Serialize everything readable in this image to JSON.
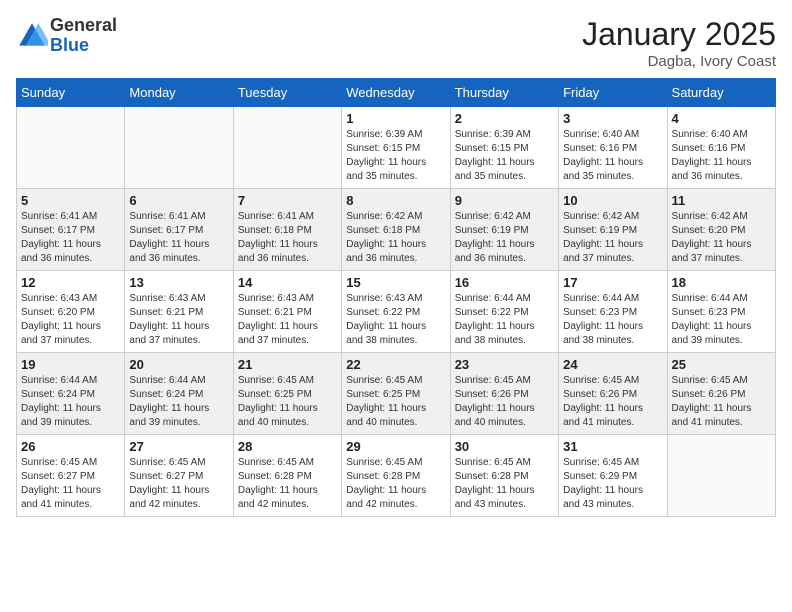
{
  "header": {
    "logo_general": "General",
    "logo_blue": "Blue",
    "month_title": "January 2025",
    "subtitle": "Dagba, Ivory Coast"
  },
  "days_of_week": [
    "Sunday",
    "Monday",
    "Tuesday",
    "Wednesday",
    "Thursday",
    "Friday",
    "Saturday"
  ],
  "weeks": [
    [
      {
        "day": "",
        "info": ""
      },
      {
        "day": "",
        "info": ""
      },
      {
        "day": "",
        "info": ""
      },
      {
        "day": "1",
        "info": "Sunrise: 6:39 AM\nSunset: 6:15 PM\nDaylight: 11 hours\nand 35 minutes."
      },
      {
        "day": "2",
        "info": "Sunrise: 6:39 AM\nSunset: 6:15 PM\nDaylight: 11 hours\nand 35 minutes."
      },
      {
        "day": "3",
        "info": "Sunrise: 6:40 AM\nSunset: 6:16 PM\nDaylight: 11 hours\nand 35 minutes."
      },
      {
        "day": "4",
        "info": "Sunrise: 6:40 AM\nSunset: 6:16 PM\nDaylight: 11 hours\nand 36 minutes."
      }
    ],
    [
      {
        "day": "5",
        "info": "Sunrise: 6:41 AM\nSunset: 6:17 PM\nDaylight: 11 hours\nand 36 minutes."
      },
      {
        "day": "6",
        "info": "Sunrise: 6:41 AM\nSunset: 6:17 PM\nDaylight: 11 hours\nand 36 minutes."
      },
      {
        "day": "7",
        "info": "Sunrise: 6:41 AM\nSunset: 6:18 PM\nDaylight: 11 hours\nand 36 minutes."
      },
      {
        "day": "8",
        "info": "Sunrise: 6:42 AM\nSunset: 6:18 PM\nDaylight: 11 hours\nand 36 minutes."
      },
      {
        "day": "9",
        "info": "Sunrise: 6:42 AM\nSunset: 6:19 PM\nDaylight: 11 hours\nand 36 minutes."
      },
      {
        "day": "10",
        "info": "Sunrise: 6:42 AM\nSunset: 6:19 PM\nDaylight: 11 hours\nand 37 minutes."
      },
      {
        "day": "11",
        "info": "Sunrise: 6:42 AM\nSunset: 6:20 PM\nDaylight: 11 hours\nand 37 minutes."
      }
    ],
    [
      {
        "day": "12",
        "info": "Sunrise: 6:43 AM\nSunset: 6:20 PM\nDaylight: 11 hours\nand 37 minutes."
      },
      {
        "day": "13",
        "info": "Sunrise: 6:43 AM\nSunset: 6:21 PM\nDaylight: 11 hours\nand 37 minutes."
      },
      {
        "day": "14",
        "info": "Sunrise: 6:43 AM\nSunset: 6:21 PM\nDaylight: 11 hours\nand 37 minutes."
      },
      {
        "day": "15",
        "info": "Sunrise: 6:43 AM\nSunset: 6:22 PM\nDaylight: 11 hours\nand 38 minutes."
      },
      {
        "day": "16",
        "info": "Sunrise: 6:44 AM\nSunset: 6:22 PM\nDaylight: 11 hours\nand 38 minutes."
      },
      {
        "day": "17",
        "info": "Sunrise: 6:44 AM\nSunset: 6:23 PM\nDaylight: 11 hours\nand 38 minutes."
      },
      {
        "day": "18",
        "info": "Sunrise: 6:44 AM\nSunset: 6:23 PM\nDaylight: 11 hours\nand 39 minutes."
      }
    ],
    [
      {
        "day": "19",
        "info": "Sunrise: 6:44 AM\nSunset: 6:24 PM\nDaylight: 11 hours\nand 39 minutes."
      },
      {
        "day": "20",
        "info": "Sunrise: 6:44 AM\nSunset: 6:24 PM\nDaylight: 11 hours\nand 39 minutes."
      },
      {
        "day": "21",
        "info": "Sunrise: 6:45 AM\nSunset: 6:25 PM\nDaylight: 11 hours\nand 40 minutes."
      },
      {
        "day": "22",
        "info": "Sunrise: 6:45 AM\nSunset: 6:25 PM\nDaylight: 11 hours\nand 40 minutes."
      },
      {
        "day": "23",
        "info": "Sunrise: 6:45 AM\nSunset: 6:26 PM\nDaylight: 11 hours\nand 40 minutes."
      },
      {
        "day": "24",
        "info": "Sunrise: 6:45 AM\nSunset: 6:26 PM\nDaylight: 11 hours\nand 41 minutes."
      },
      {
        "day": "25",
        "info": "Sunrise: 6:45 AM\nSunset: 6:26 PM\nDaylight: 11 hours\nand 41 minutes."
      }
    ],
    [
      {
        "day": "26",
        "info": "Sunrise: 6:45 AM\nSunset: 6:27 PM\nDaylight: 11 hours\nand 41 minutes."
      },
      {
        "day": "27",
        "info": "Sunrise: 6:45 AM\nSunset: 6:27 PM\nDaylight: 11 hours\nand 42 minutes."
      },
      {
        "day": "28",
        "info": "Sunrise: 6:45 AM\nSunset: 6:28 PM\nDaylight: 11 hours\nand 42 minutes."
      },
      {
        "day": "29",
        "info": "Sunrise: 6:45 AM\nSunset: 6:28 PM\nDaylight: 11 hours\nand 42 minutes."
      },
      {
        "day": "30",
        "info": "Sunrise: 6:45 AM\nSunset: 6:28 PM\nDaylight: 11 hours\nand 43 minutes."
      },
      {
        "day": "31",
        "info": "Sunrise: 6:45 AM\nSunset: 6:29 PM\nDaylight: 11 hours\nand 43 minutes."
      },
      {
        "day": "",
        "info": ""
      }
    ]
  ]
}
